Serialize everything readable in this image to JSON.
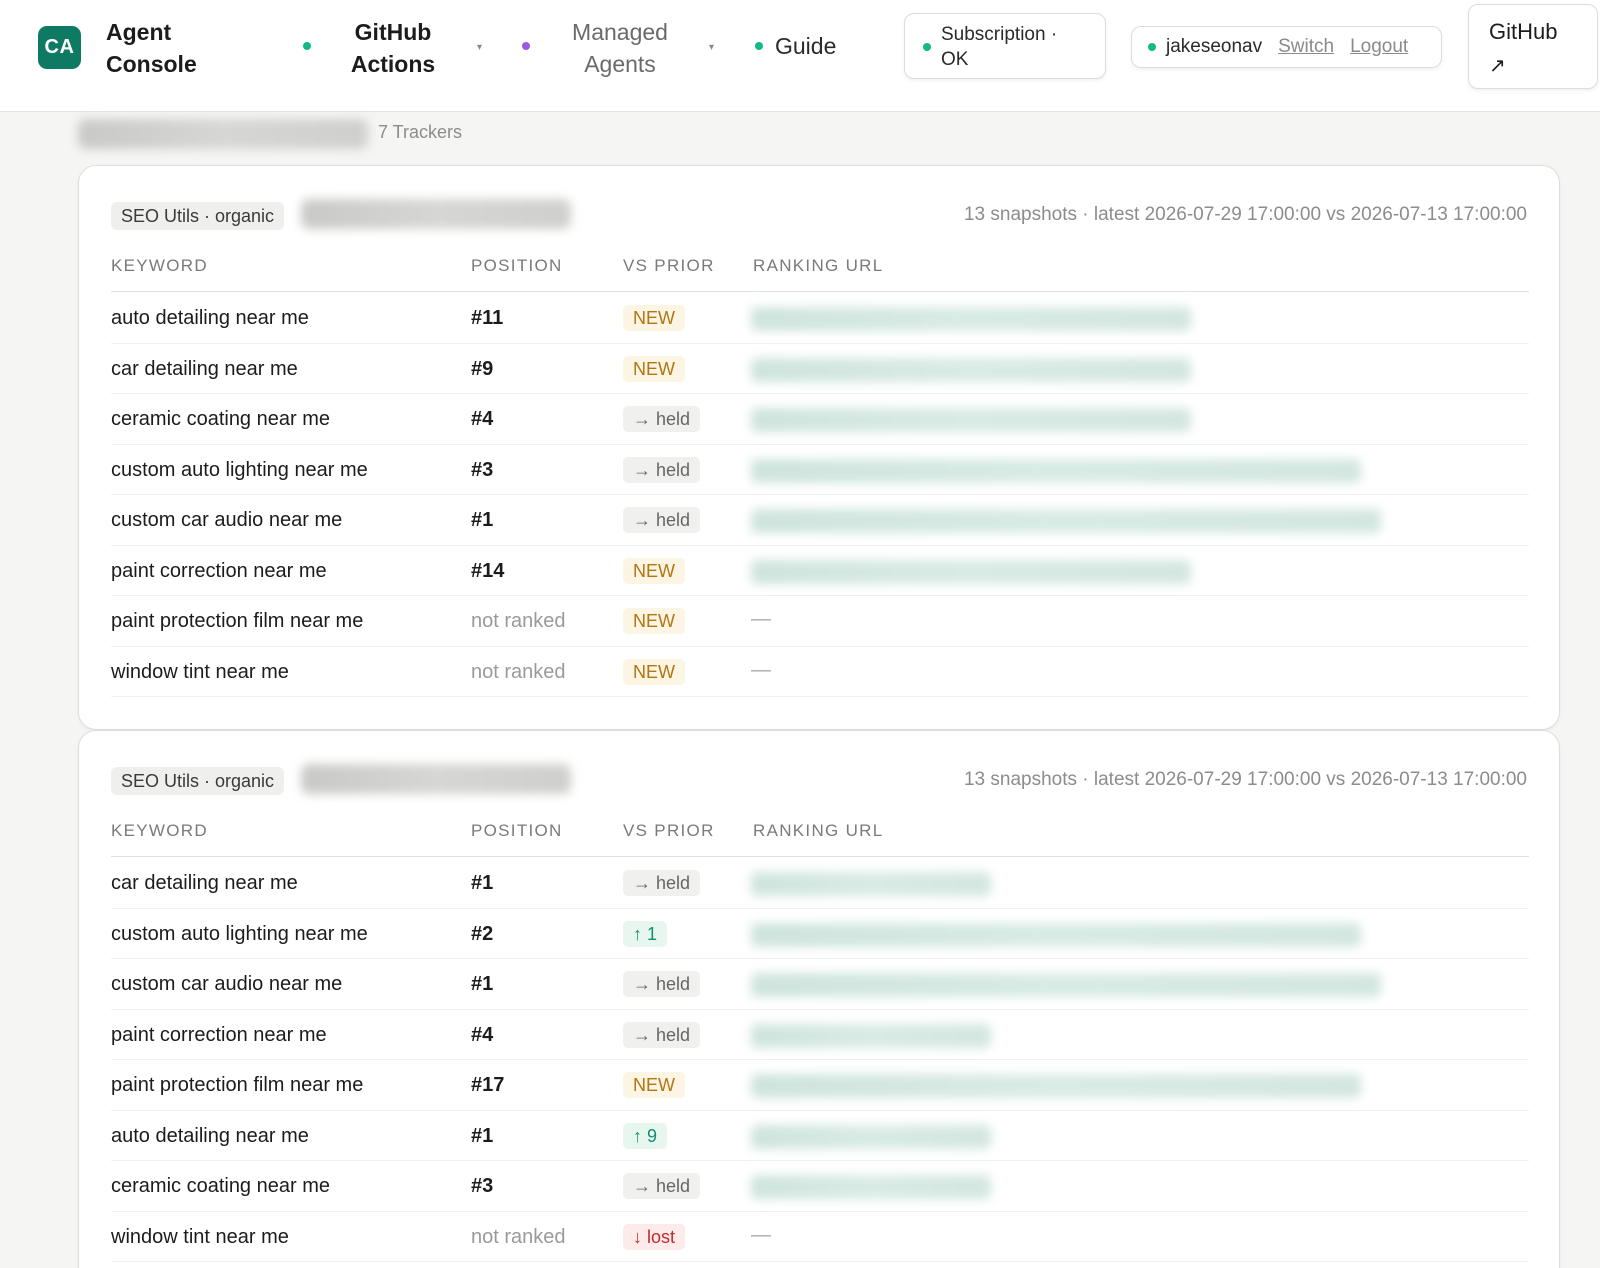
{
  "header": {
    "logo": "CA",
    "brand_line1": "Agent",
    "brand_line2": "Console",
    "nav": {
      "github_actions_1": "GitHub",
      "github_actions_2": "Actions",
      "managed_agents_1": "Managed",
      "managed_agents_2": "Agents",
      "guide": "Guide"
    },
    "subscription_1": "Subscription ·",
    "subscription_2": "OK",
    "username": "jakeseonav",
    "switch_label": "Switch",
    "logout_label": "Logout",
    "github_button": "GitHub",
    "github_arrow": "↗"
  },
  "subheader": {
    "trackers": "7 Trackers"
  },
  "colors": {
    "accent": "#0f7a63",
    "status_ok": "#12b886",
    "nav_purple": "#9b59e0"
  },
  "table_headers": {
    "keyword": "KEYWORD",
    "position": "POSITION",
    "vs_prior": "VS PRIOR",
    "ranking_url": "RANKING URL"
  },
  "cards": [
    {
      "tag": "SEO Utils · organic",
      "meta": "13 snapshots · latest 2026-07-29 17:00:00 vs 2026-07-13 17:00:00",
      "rows": [
        {
          "keyword": "auto detailing near me",
          "position": "#11",
          "change": "NEW",
          "change_type": "new",
          "url_shown": true
        },
        {
          "keyword": "car detailing near me",
          "position": "#9",
          "change": "NEW",
          "change_type": "new",
          "url_shown": true
        },
        {
          "keyword": "ceramic coating near me",
          "position": "#4",
          "change": "→ held",
          "change_type": "held",
          "url_shown": true
        },
        {
          "keyword": "custom auto lighting near me",
          "position": "#3",
          "change": "→ held",
          "change_type": "held",
          "url_shown": true
        },
        {
          "keyword": "custom car audio near me",
          "position": "#1",
          "change": "→ held",
          "change_type": "held",
          "url_shown": true
        },
        {
          "keyword": "paint correction near me",
          "position": "#14",
          "change": "NEW",
          "change_type": "new",
          "url_shown": true
        },
        {
          "keyword": "paint protection film near me",
          "position": "not ranked",
          "change": "NEW",
          "change_type": "new",
          "url_shown": false,
          "url_text": "—"
        },
        {
          "keyword": "window tint near me",
          "position": "not ranked",
          "change": "NEW",
          "change_type": "new",
          "url_shown": false,
          "url_text": "—"
        }
      ]
    },
    {
      "tag": "SEO Utils · organic",
      "meta": "13 snapshots · latest 2026-07-29 17:00:00 vs 2026-07-13 17:00:00",
      "rows": [
        {
          "keyword": "car detailing near me",
          "position": "#1",
          "change": "→ held",
          "change_type": "held",
          "url_shown": true
        },
        {
          "keyword": "custom auto lighting near me",
          "position": "#2",
          "change": "↑ 1",
          "change_type": "up",
          "url_shown": true
        },
        {
          "keyword": "custom car audio near me",
          "position": "#1",
          "change": "→ held",
          "change_type": "held",
          "url_shown": true
        },
        {
          "keyword": "paint correction near me",
          "position": "#4",
          "change": "→ held",
          "change_type": "held",
          "url_shown": true
        },
        {
          "keyword": "paint protection film near me",
          "position": "#17",
          "change": "NEW",
          "change_type": "new",
          "url_shown": true
        },
        {
          "keyword": "auto detailing near me",
          "position": "#1",
          "change": "↑ 9",
          "change_type": "up",
          "url_shown": true
        },
        {
          "keyword": "ceramic coating near me",
          "position": "#3",
          "change": "→ held",
          "change_type": "held",
          "url_shown": true
        },
        {
          "keyword": "window tint near me",
          "position": "not ranked",
          "change": "↓ lost",
          "change_type": "lost",
          "url_shown": false,
          "url_text": "—"
        }
      ]
    }
  ]
}
